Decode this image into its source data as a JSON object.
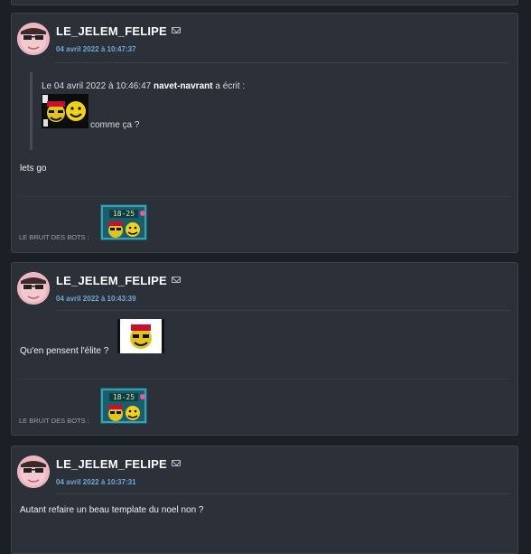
{
  "posts": [
    {
      "author": "LE_JELEM_FELIPE",
      "date": "04 avril 2022 à 10:47:37",
      "quote": {
        "prefix": "Le 04 avril 2022 à 10:46:47",
        "quoted_author": "navet-navrant",
        "suffix": "a écrit :",
        "caption": "comme ça ?"
      },
      "body": "lets go",
      "signature_label": "LE BRUIT DES BOTS :",
      "signature_badge": "18-25"
    },
    {
      "author": "LE_JELEM_FELIPE",
      "date": "04 avril 2022 à 10:43:39",
      "body": "Qu'en pensent l'élite ?",
      "signature_label": "LE BRUIT DES BOTS :",
      "signature_badge": "18-25"
    },
    {
      "author": "LE_JELEM_FELIPE",
      "date": "04 avril 2022 à 10:37:31",
      "body": "Autant refaire un beau template du noel non ?"
    }
  ],
  "colors": {
    "background": "#1c1f25",
    "card": "#2c3038",
    "date": "#6eaad8"
  },
  "icons": [
    "mail-icon",
    "avatar",
    "sticker"
  ]
}
